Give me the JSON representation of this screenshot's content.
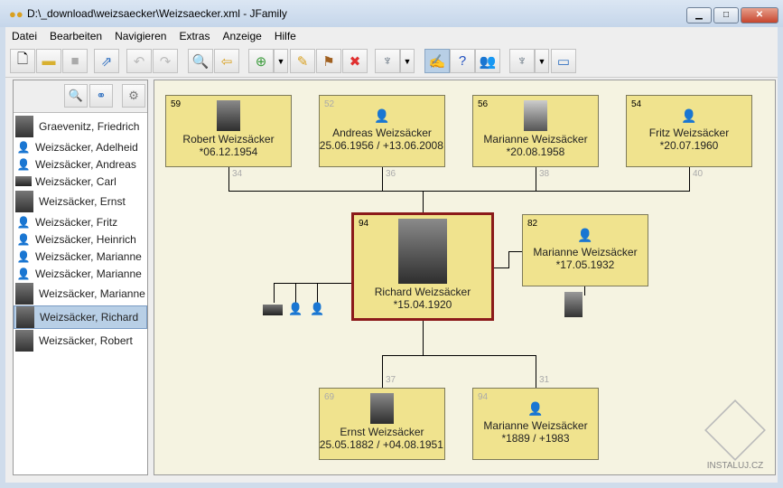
{
  "window": {
    "title": "D:\\_download\\weizsaecker\\Weizsaecker.xml - JFamily",
    "min": "▁",
    "max": "□",
    "close": "✕"
  },
  "menu": [
    "Datei",
    "Bearbeiten",
    "Navigieren",
    "Extras",
    "Anzeige",
    "Hilfe"
  ],
  "toolbar_icons": [
    "new-file",
    "open-folder",
    "save",
    "export",
    "undo",
    "redo",
    "search",
    "back",
    "add",
    "dropdown",
    "edit",
    "signpost",
    "delete",
    "tree-view",
    "dropdown",
    "notes",
    "help",
    "persons",
    "tree-view-2",
    "dropdown",
    "window"
  ],
  "list": [
    {
      "name": "Graevenitz, Friedrich",
      "type": "photo"
    },
    {
      "name": "Weizsäcker, Adelheid",
      "type": "female"
    },
    {
      "name": "Weizsäcker, Andreas",
      "type": "male"
    },
    {
      "name": "Weizsäcker, Carl",
      "type": "small-photo"
    },
    {
      "name": "Weizsäcker, Ernst",
      "type": "photo"
    },
    {
      "name": "Weizsäcker, Fritz",
      "type": "male"
    },
    {
      "name": "Weizsäcker, Heinrich",
      "type": "male"
    },
    {
      "name": "Weizsäcker, Marianne",
      "type": "female"
    },
    {
      "name": "Weizsäcker, Marianne",
      "type": "female"
    },
    {
      "name": "Weizsäcker, Marianne",
      "type": "photo"
    },
    {
      "name": "Weizsäcker, Richard",
      "type": "photo",
      "selected": true
    },
    {
      "name": "Weizsäcker, Robert",
      "type": "photo"
    }
  ],
  "tree": {
    "children": [
      {
        "num": "59",
        "name": "Robert Weizsäcker",
        "date": "*06.12.1954",
        "link": "34"
      },
      {
        "num": "52",
        "name": "Andreas Weizsäcker",
        "date": "*25.06.1956 / +13.06.2008",
        "link": "36"
      },
      {
        "num": "56",
        "name": "Marianne Weizsäcker",
        "date": "*20.08.1958",
        "link": "38"
      },
      {
        "num": "54",
        "name": "Fritz Weizsäcker",
        "date": "*20.07.1960",
        "link": "40"
      }
    ],
    "main": {
      "num": "94",
      "name": "Richard Weizsäcker",
      "date": "*15.04.1920"
    },
    "spouse": {
      "num": "82",
      "name": "Marianne Weizsäcker",
      "date": "*17.05.1932"
    },
    "parents": [
      {
        "num": "69",
        "name": "Ernst Weizsäcker",
        "date": "*25.05.1882 / +04.08.1951",
        "link": "37"
      },
      {
        "num": "94",
        "name": "Marianne Weizsäcker",
        "date": "*1889 / +1983",
        "link": "31"
      }
    ]
  },
  "watermark": "INSTALUJ.CZ"
}
